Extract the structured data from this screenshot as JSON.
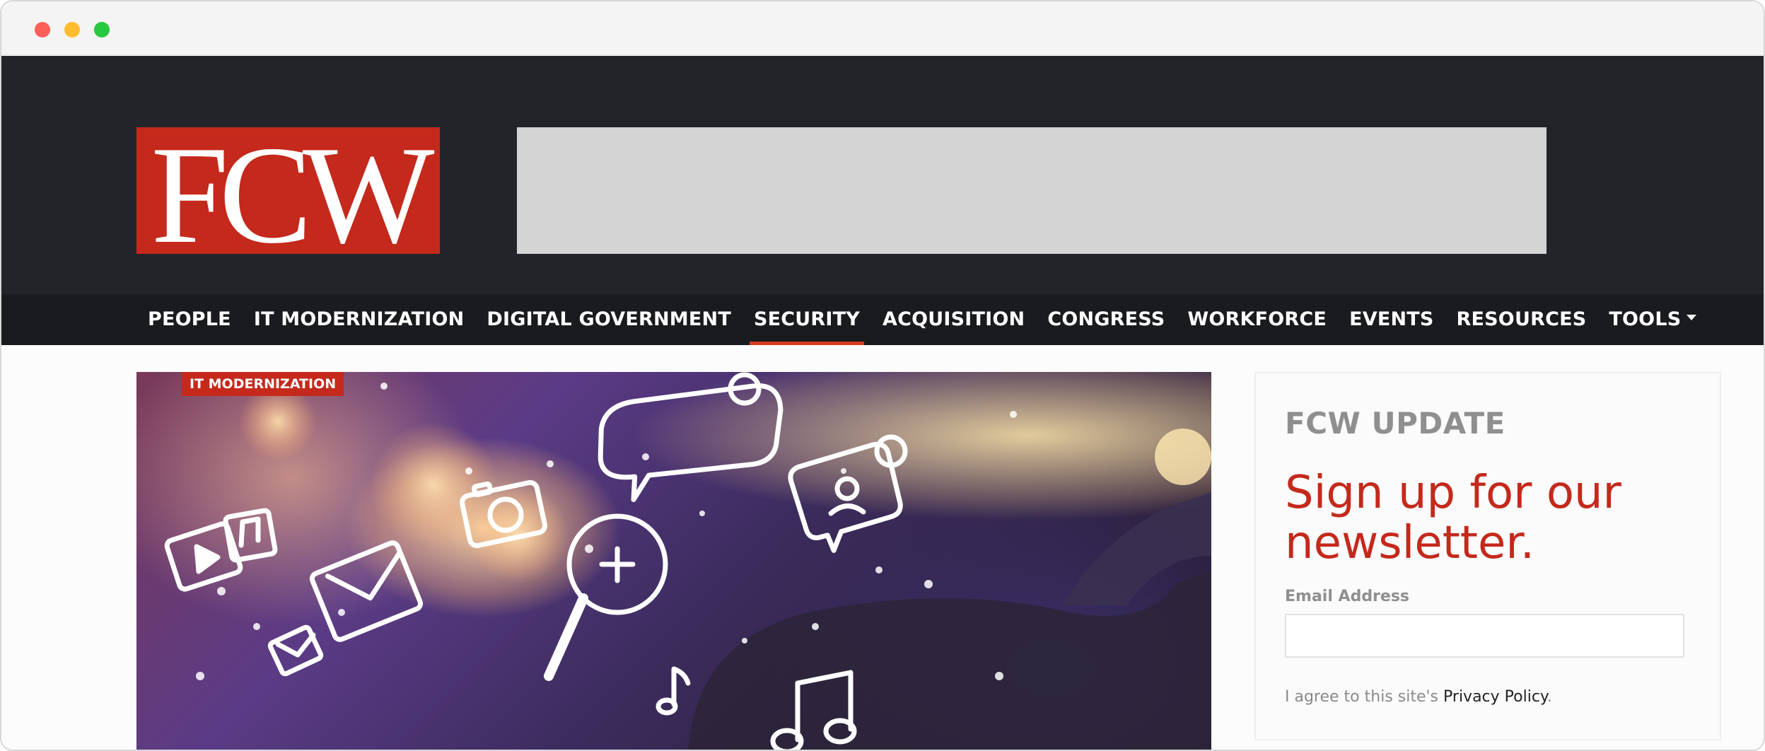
{
  "window": {
    "controls": [
      "close",
      "minimize",
      "maximize"
    ]
  },
  "header": {
    "logo_text": "FCW",
    "logo_color": "#c4291c",
    "background_color": "#23242a"
  },
  "nav": {
    "items": [
      {
        "label": "PEOPLE"
      },
      {
        "label": "IT MODERNIZATION"
      },
      {
        "label": "DIGITAL GOVERNMENT"
      },
      {
        "label": "SECURITY",
        "active": true
      },
      {
        "label": "ACQUISITION"
      },
      {
        "label": "CONGRESS"
      },
      {
        "label": "WORKFORCE"
      },
      {
        "label": "EVENTS"
      },
      {
        "label": "RESOURCES"
      },
      {
        "label": "TOOLS",
        "dropdown": true
      }
    ],
    "active_color": "#d63a20"
  },
  "hero": {
    "category": "IT MODERNIZATION",
    "icons": [
      "video-icon",
      "music-icon",
      "mail-icon",
      "camera-icon",
      "search-icon",
      "chat-bubble-icon",
      "user-message-icon",
      "music-note-icon"
    ]
  },
  "newsletter": {
    "kicker": "FCW UPDATE",
    "headline": "Sign up for our newsletter.",
    "email_label": "Email Address",
    "email_value": "",
    "consent_prefix": "I agree to this site's ",
    "consent_link": "Privacy Policy",
    "consent_suffix": ".",
    "accent_color": "#c4291c"
  }
}
